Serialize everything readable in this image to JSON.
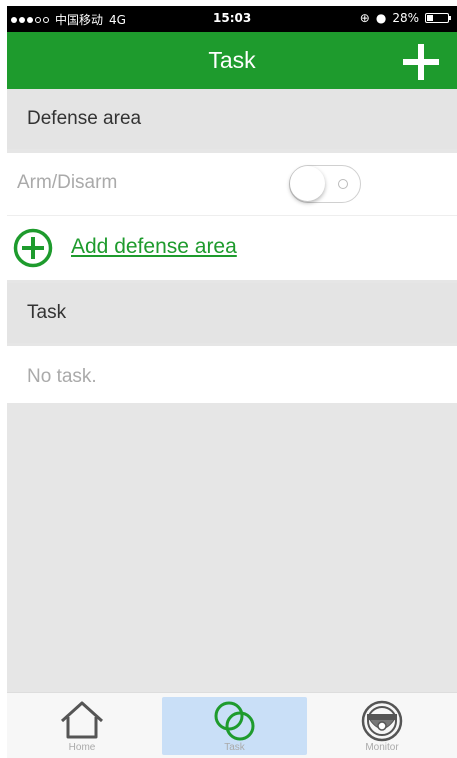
{
  "status_bar": {
    "carrier": "中国移动",
    "network": "4G",
    "time": "15:03",
    "battery": "28%",
    "battery_level": 0.28
  },
  "nav": {
    "title": "Task",
    "add_icon": "plus-icon"
  },
  "defense": {
    "header": "Defense area",
    "arm_label": "Arm/Disarm",
    "arm_on": false,
    "add_label": "Add defense area"
  },
  "task": {
    "header": "Task",
    "empty_label": "No task."
  },
  "tabs": [
    {
      "label": "Home",
      "icon": "home-icon",
      "active": false
    },
    {
      "label": "Task",
      "icon": "task-icon",
      "active": true
    },
    {
      "label": "Monitor",
      "icon": "camera-icon",
      "active": false
    }
  ],
  "colors": {
    "accent": "#1e9b2d",
    "active_tab_bg": "#c9dff7"
  }
}
